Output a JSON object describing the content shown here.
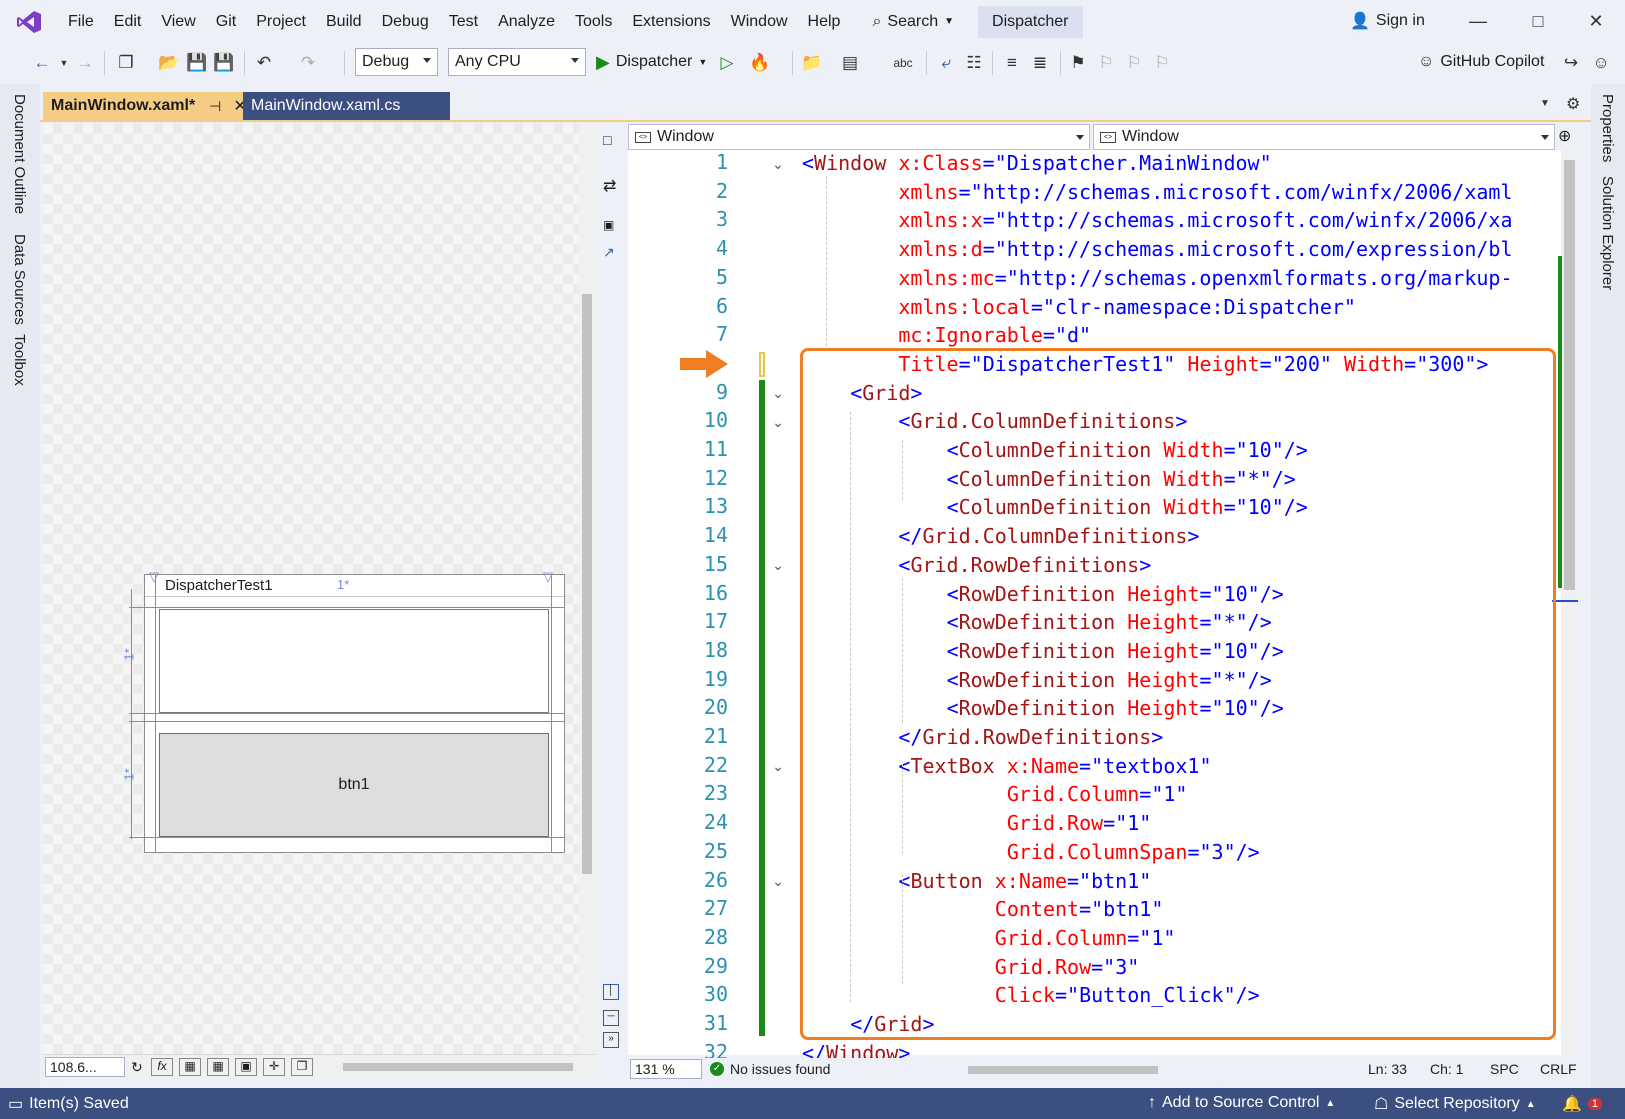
{
  "menubar": {
    "items": [
      "File",
      "Edit",
      "View",
      "Git",
      "Project",
      "Build",
      "Debug",
      "Test",
      "Analyze",
      "Tools",
      "Extensions",
      "Window",
      "Help"
    ],
    "search_label": "Search",
    "solution_name": "Dispatcher",
    "sign_in": "Sign in"
  },
  "toolbar": {
    "config": "Debug",
    "platform": "Any CPU",
    "run_target": "Dispatcher",
    "copilot": "GitHub Copilot"
  },
  "side_tabs": {
    "left": [
      "Document Outline",
      "Data Sources",
      "Toolbox"
    ],
    "right": [
      "Properties",
      "Solution Explorer"
    ]
  },
  "tabs": {
    "active": "MainWindow.xaml*",
    "inactive": "MainWindow.xaml.cs"
  },
  "designer": {
    "window_title": "DispatcherTest1",
    "column_label": "1*",
    "row_label_1": "1*",
    "row_label_2": "1*",
    "button_content": "btn1",
    "zoom": "108.6..."
  },
  "navbar": {
    "left": "Window",
    "right": "Window"
  },
  "editor": {
    "zoom": "131 %",
    "issues": "No issues found",
    "line": "Ln: 33",
    "col": "Ch: 1",
    "spaces": "SPC",
    "eol": "CRLF",
    "lines": [
      {
        "n": "1",
        "indent": 0,
        "tokens": [
          [
            "b",
            "<"
          ],
          [
            "m",
            "Window"
          ],
          [
            "k",
            " "
          ],
          [
            "r",
            "x:Class"
          ],
          [
            "b",
            "=\"Dispatcher.MainWindow\""
          ]
        ]
      },
      {
        "n": "2",
        "indent": 8,
        "tokens": [
          [
            "r",
            "xmlns"
          ],
          [
            "b",
            "=\"http://schemas.microsoft.com/winfx/2006/xaml"
          ]
        ]
      },
      {
        "n": "3",
        "indent": 8,
        "tokens": [
          [
            "r",
            "xmlns:x"
          ],
          [
            "b",
            "=\"http://schemas.microsoft.com/winfx/2006/xa"
          ]
        ]
      },
      {
        "n": "4",
        "indent": 8,
        "tokens": [
          [
            "r",
            "xmlns:d"
          ],
          [
            "b",
            "=\"http://schemas.microsoft.com/expression/bl"
          ]
        ]
      },
      {
        "n": "5",
        "indent": 8,
        "tokens": [
          [
            "r",
            "xmlns:mc"
          ],
          [
            "b",
            "=\"http://schemas.openxmlformats.org/markup-"
          ]
        ]
      },
      {
        "n": "6",
        "indent": 8,
        "tokens": [
          [
            "r",
            "xmlns:local"
          ],
          [
            "b",
            "=\"clr-namespace:Dispatcher\""
          ]
        ]
      },
      {
        "n": "7",
        "indent": 8,
        "tokens": [
          [
            "r",
            "mc:Ignorable"
          ],
          [
            "b",
            "=\"d\""
          ]
        ]
      },
      {
        "n": "",
        "indent": 8,
        "tokens": [
          [
            "r",
            "Title"
          ],
          [
            "b",
            "=\"DispatcherTest1\""
          ],
          [
            "k",
            " "
          ],
          [
            "r",
            "Height"
          ],
          [
            "b",
            "=\"200\""
          ],
          [
            "k",
            " "
          ],
          [
            "r",
            "Width"
          ],
          [
            "b",
            "=\"300\">"
          ]
        ]
      },
      {
        "n": "9",
        "indent": 4,
        "tokens": [
          [
            "b",
            "<"
          ],
          [
            "m",
            "Grid"
          ],
          [
            "b",
            ">"
          ]
        ]
      },
      {
        "n": "10",
        "indent": 8,
        "tokens": [
          [
            "b",
            "<"
          ],
          [
            "m",
            "Grid.ColumnDefinitions"
          ],
          [
            "b",
            ">"
          ]
        ]
      },
      {
        "n": "11",
        "indent": 12,
        "tokens": [
          [
            "b",
            "<"
          ],
          [
            "m",
            "ColumnDefinition"
          ],
          [
            "k",
            " "
          ],
          [
            "r",
            "Width"
          ],
          [
            "b",
            "=\"10\"/>"
          ]
        ]
      },
      {
        "n": "12",
        "indent": 12,
        "tokens": [
          [
            "b",
            "<"
          ],
          [
            "m",
            "ColumnDefinition"
          ],
          [
            "k",
            " "
          ],
          [
            "r",
            "Width"
          ],
          [
            "b",
            "=\"*\"/>"
          ]
        ]
      },
      {
        "n": "13",
        "indent": 12,
        "tokens": [
          [
            "b",
            "<"
          ],
          [
            "m",
            "ColumnDefinition"
          ],
          [
            "k",
            " "
          ],
          [
            "r",
            "Width"
          ],
          [
            "b",
            "=\"10\"/>"
          ]
        ]
      },
      {
        "n": "14",
        "indent": 8,
        "tokens": [
          [
            "b",
            "</"
          ],
          [
            "m",
            "Grid.ColumnDefinitions"
          ],
          [
            "b",
            ">"
          ]
        ]
      },
      {
        "n": "15",
        "indent": 8,
        "tokens": [
          [
            "b",
            "<"
          ],
          [
            "m",
            "Grid.RowDefinitions"
          ],
          [
            "b",
            ">"
          ]
        ]
      },
      {
        "n": "16",
        "indent": 12,
        "tokens": [
          [
            "b",
            "<"
          ],
          [
            "m",
            "RowDefinition"
          ],
          [
            "k",
            " "
          ],
          [
            "r",
            "Height"
          ],
          [
            "b",
            "=\"10\"/>"
          ]
        ]
      },
      {
        "n": "17",
        "indent": 12,
        "tokens": [
          [
            "b",
            "<"
          ],
          [
            "m",
            "RowDefinition"
          ],
          [
            "k",
            " "
          ],
          [
            "r",
            "Height"
          ],
          [
            "b",
            "=\"*\"/>"
          ]
        ]
      },
      {
        "n": "18",
        "indent": 12,
        "tokens": [
          [
            "b",
            "<"
          ],
          [
            "m",
            "RowDefinition"
          ],
          [
            "k",
            " "
          ],
          [
            "r",
            "Height"
          ],
          [
            "b",
            "=\"10\"/>"
          ]
        ]
      },
      {
        "n": "19",
        "indent": 12,
        "tokens": [
          [
            "b",
            "<"
          ],
          [
            "m",
            "RowDefinition"
          ],
          [
            "k",
            " "
          ],
          [
            "r",
            "Height"
          ],
          [
            "b",
            "=\"*\"/>"
          ]
        ]
      },
      {
        "n": "20",
        "indent": 12,
        "tokens": [
          [
            "b",
            "<"
          ],
          [
            "m",
            "RowDefinition"
          ],
          [
            "k",
            " "
          ],
          [
            "r",
            "Height"
          ],
          [
            "b",
            "=\"10\"/>"
          ]
        ]
      },
      {
        "n": "21",
        "indent": 8,
        "tokens": [
          [
            "b",
            "</"
          ],
          [
            "m",
            "Grid.RowDefinitions"
          ],
          [
            "b",
            ">"
          ]
        ]
      },
      {
        "n": "22",
        "indent": 8,
        "tokens": [
          [
            "b",
            "<"
          ],
          [
            "m",
            "TextBox"
          ],
          [
            "k",
            " "
          ],
          [
            "r",
            "x:Name"
          ],
          [
            "b",
            "=\"textbox1\""
          ]
        ]
      },
      {
        "n": "23",
        "indent": 17,
        "tokens": [
          [
            "r",
            "Grid.Column"
          ],
          [
            "b",
            "=\"1\""
          ]
        ]
      },
      {
        "n": "24",
        "indent": 17,
        "tokens": [
          [
            "r",
            "Grid.Row"
          ],
          [
            "b",
            "=\"1\""
          ]
        ]
      },
      {
        "n": "25",
        "indent": 17,
        "tokens": [
          [
            "r",
            "Grid.ColumnSpan"
          ],
          [
            "b",
            "=\"3\"/>"
          ]
        ]
      },
      {
        "n": "26",
        "indent": 8,
        "tokens": [
          [
            "b",
            "<"
          ],
          [
            "m",
            "Button"
          ],
          [
            "k",
            " "
          ],
          [
            "r",
            "x:Name"
          ],
          [
            "b",
            "=\"btn1\""
          ]
        ]
      },
      {
        "n": "27",
        "indent": 16,
        "tokens": [
          [
            "r",
            "Content"
          ],
          [
            "b",
            "=\"btn1\""
          ]
        ]
      },
      {
        "n": "28",
        "indent": 16,
        "tokens": [
          [
            "r",
            "Grid.Column"
          ],
          [
            "b",
            "=\"1\""
          ]
        ]
      },
      {
        "n": "29",
        "indent": 16,
        "tokens": [
          [
            "r",
            "Grid.Row"
          ],
          [
            "b",
            "=\"3\""
          ]
        ]
      },
      {
        "n": "30",
        "indent": 16,
        "tokens": [
          [
            "r",
            "Click"
          ],
          [
            "b",
            "=\"Button_Click\"/>"
          ]
        ]
      },
      {
        "n": "31",
        "indent": 4,
        "tokens": [
          [
            "b",
            "</"
          ],
          [
            "m",
            "Grid"
          ],
          [
            "b",
            ">"
          ]
        ]
      },
      {
        "n": "32",
        "indent": 0,
        "tokens": [
          [
            "b",
            "</"
          ],
          [
            "m",
            "Window"
          ],
          [
            "b",
            ">"
          ]
        ]
      }
    ]
  },
  "statusbar": {
    "message": "Item(s) Saved",
    "source_control": "Add to Source Control",
    "repository": "Select Repository",
    "notifications": "1"
  },
  "colors": {
    "accent": "#3b4f81",
    "highlight_box": "#ef7d22",
    "change_bar": "#1a8a1a",
    "tag": "#a31515",
    "attr": "#ff0000",
    "value": "#0000ff"
  }
}
